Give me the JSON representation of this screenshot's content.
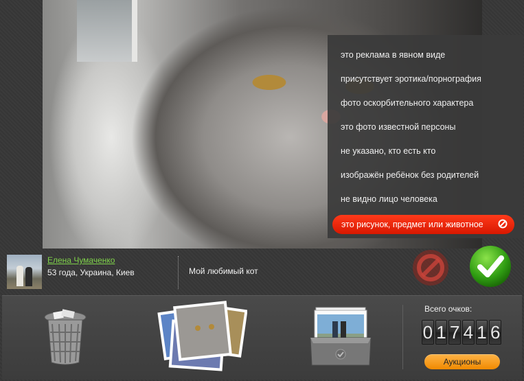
{
  "photo": {
    "icon": "cat-photo"
  },
  "menu": {
    "items": [
      "это реклама в явном виде",
      "присутствует эротика/порнография",
      "фото оскорбительного характера",
      "это фото известной персоны",
      "не указано, кто есть кто",
      "изображён ребёнок без родителей",
      "не видно лицо человека"
    ],
    "selected": "это рисунок, предмет или животное"
  },
  "user": {
    "name": "Елена Чумаченко",
    "info": "53 года, Украина, Киев",
    "caption": "Мой любимый кот"
  },
  "actions": {
    "reject_icon": "ban-icon",
    "approve_icon": "checkmark-icon"
  },
  "toolbar": {
    "trash_icon": "trash-icon",
    "stack_icon": "photo-stack-icon",
    "album_icon": "album-tray-icon"
  },
  "score": {
    "label": "Всего очков:",
    "digits": [
      "0",
      "1",
      "7",
      "4",
      "1",
      "6"
    ]
  },
  "auction_label": "Аукционы",
  "colors": {
    "accent_red": "#e82a0c",
    "accent_green": "#3cb01a",
    "accent_orange": "#f59a1a",
    "name_green": "#7fd24a"
  }
}
